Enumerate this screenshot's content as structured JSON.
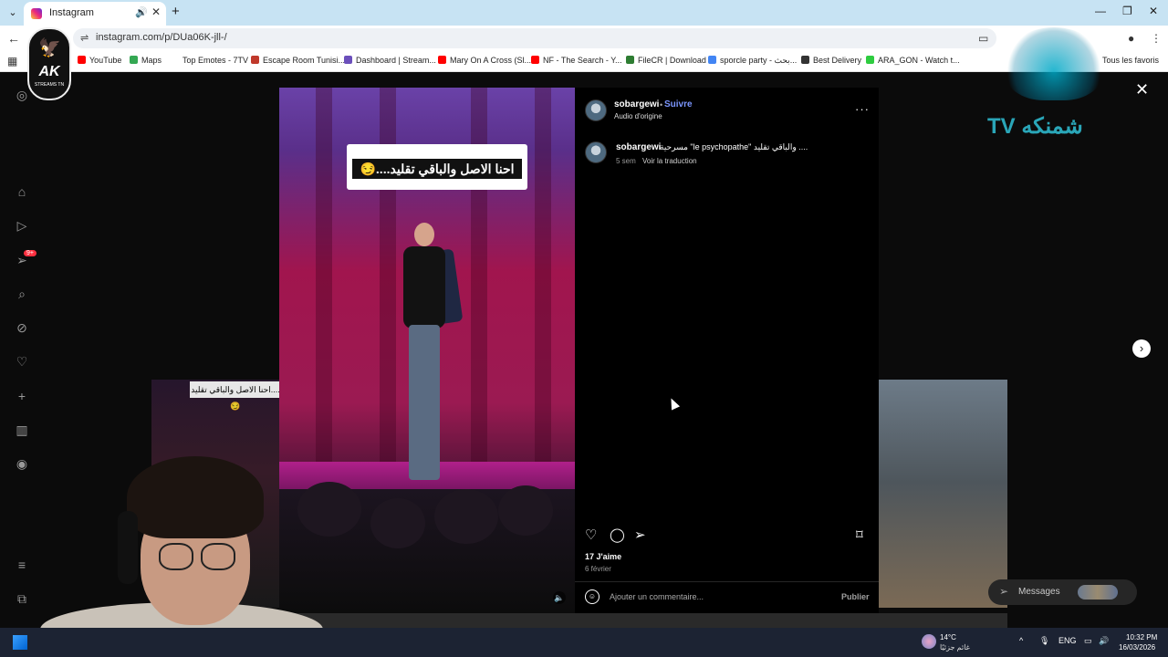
{
  "browser": {
    "tab_title": "Instagram",
    "url": "instagram.com/p/DUa06K-jll-/",
    "bookmarks": [
      {
        "label": "YouTube",
        "color": "#ff0000"
      },
      {
        "label": "Maps",
        "color": "#34a853"
      },
      {
        "label": "Top Emotes - 7TV",
        "color": "#ffffff"
      },
      {
        "label": "Escape Room Tunisi...",
        "color": "#c0392b"
      },
      {
        "label": "Dashboard | Stream...",
        "color": "#6b4fbb"
      },
      {
        "label": "Mary On A Cross (Sl...",
        "color": "#ff0000"
      },
      {
        "label": "NF - The Search - Y...",
        "color": "#ff0000"
      },
      {
        "label": "FileCR | Download",
        "color": "#2e7d32"
      },
      {
        "label": "sporcle party - بحث...",
        "color": "#4285f4"
      },
      {
        "label": "Best Delivery",
        "color": "#333333"
      },
      {
        "label": "ARA_GON - Watch t...",
        "color": "#2ecc40"
      }
    ],
    "all_bookmarks": "Tous les favoris"
  },
  "post": {
    "username": "sobargewi",
    "separator": "•",
    "follow": "Suivre",
    "audio": "Audio d'origine",
    "more": "···",
    "caption": "مسرحية \"le psychopathe\" والباقي تقليد ....",
    "time_ago": "5 sem",
    "translate": "Voir la traduction",
    "likes": "17 J'aime",
    "date": "6 février",
    "comment_placeholder": "Ajouter un commentaire...",
    "publish": "Publier",
    "video_caption": "احنا الاصل والباقي تقليد....😏",
    "bg_reel_caption": "احنا الاصل والباقي تقليد....😏"
  },
  "nav": {
    "notification_badge": "9+",
    "messages": "Messages"
  },
  "overlays": {
    "ak_logo": "AK",
    "ak_sub": "STREAMS TN",
    "tv_logo": "شمنكه TV"
  },
  "taskbar": {
    "temperature": "14°C",
    "weather_text": "غائم جزئيًا",
    "lang": "ENG",
    "time": "10:32 PM",
    "date": "16/03/2026"
  }
}
